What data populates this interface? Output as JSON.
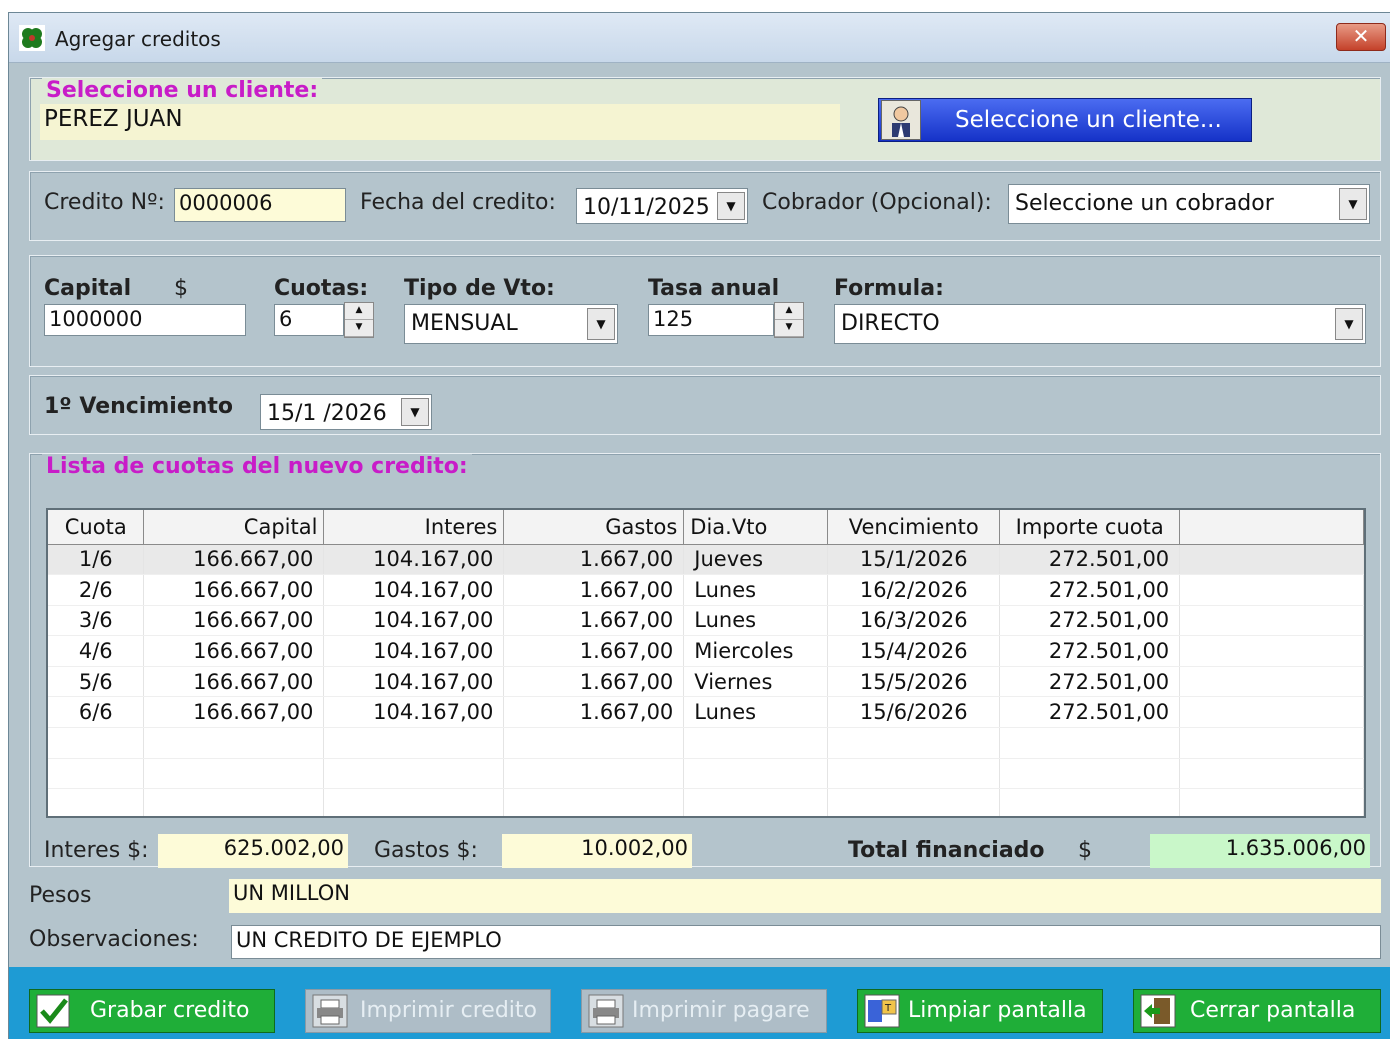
{
  "window": {
    "title": "Agregar creditos",
    "close_label": "✕"
  },
  "client": {
    "legend": "Seleccione un cliente:",
    "name": "PEREZ JUAN",
    "select_button": "Seleccione un cliente..."
  },
  "credit": {
    "number_label": "Credito Nº:",
    "number": "0000006",
    "date_label": "Fecha del credito:",
    "date": "10/11/2025",
    "collector_label": "Cobrador (Opcional):",
    "collector": "Seleccione un cobrador"
  },
  "terms": {
    "capital_label": "Capital",
    "currency": "$",
    "capital": "1000000",
    "cuotas_label": "Cuotas:",
    "cuotas": "6",
    "tipo_label": "Tipo de Vto:",
    "tipo": "MENSUAL",
    "tasa_label": "Tasa anual",
    "tasa": "125",
    "formula_label": "Formula:",
    "formula": "DIRECTO"
  },
  "vencimiento": {
    "label": "1º Vencimiento",
    "date": "15/1 /2026"
  },
  "list": {
    "legend": "Lista de cuotas del nuevo credito:",
    "columns": [
      "Cuota",
      "Capital",
      "Interes",
      "Gastos",
      "Dia.Vto",
      "Vencimiento",
      "Importe cuota"
    ],
    "rows": [
      [
        "1/6",
        "166.667,00",
        "104.167,00",
        "1.667,00",
        "Jueves",
        "15/1/2026",
        "272.501,00"
      ],
      [
        "2/6",
        "166.667,00",
        "104.167,00",
        "1.667,00",
        "Lunes",
        "16/2/2026",
        "272.501,00"
      ],
      [
        "3/6",
        "166.667,00",
        "104.167,00",
        "1.667,00",
        "Lunes",
        "16/3/2026",
        "272.501,00"
      ],
      [
        "4/6",
        "166.667,00",
        "104.167,00",
        "1.667,00",
        "Miercoles",
        "15/4/2026",
        "272.501,00"
      ],
      [
        "5/6",
        "166.667,00",
        "104.167,00",
        "1.667,00",
        "Viernes",
        "15/5/2026",
        "272.501,00"
      ],
      [
        "6/6",
        "166.667,00",
        "104.167,00",
        "1.667,00",
        "Lunes",
        "15/6/2026",
        "272.501,00"
      ]
    ]
  },
  "totals": {
    "interes_label": "Interes $:",
    "interes": "625.002,00",
    "gastos_label": "Gastos $:",
    "gastos": "10.002,00",
    "total_label": "Total financiado",
    "total_currency": "$",
    "total": "1.635.006,00"
  },
  "extra": {
    "pesos_label": "Pesos",
    "pesos": "UN MILLON",
    "obs_label": "Observaciones:",
    "obs": "UN CREDITO DE EJEMPLO"
  },
  "buttons": {
    "save": "Grabar credito",
    "print_credit": "Imprimir credito",
    "print_note": "Imprimir pagare",
    "clear": "Limpiar pantalla",
    "close": "Cerrar pantalla"
  }
}
